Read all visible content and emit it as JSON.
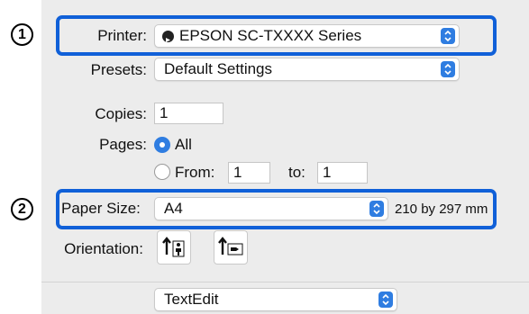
{
  "markers": [
    "1",
    "2"
  ],
  "printer": {
    "label": "Printer:",
    "value": "EPSON SC-TXXXX Series",
    "icon": "printer-status-dot-icon"
  },
  "presets": {
    "label": "Presets:",
    "value": "Default Settings"
  },
  "copies": {
    "label": "Copies:",
    "value": "1"
  },
  "pages": {
    "label": "Pages:",
    "all_label": "All",
    "from_label": "From:",
    "from_value": "1",
    "to_label": "to:",
    "to_value": "1",
    "selected": "All"
  },
  "paper_size": {
    "label": "Paper Size:",
    "value": "A4",
    "dimensions": "210 by 297 mm"
  },
  "orientation": {
    "label": "Orientation:",
    "options": [
      {
        "name": "portrait",
        "icon": "portrait-orientation-icon"
      },
      {
        "name": "landscape",
        "icon": "landscape-orientation-icon"
      }
    ]
  },
  "app_menu": {
    "value": "TextEdit"
  },
  "colors": {
    "highlight": "#1060d8",
    "accent": "#2f7de1"
  }
}
